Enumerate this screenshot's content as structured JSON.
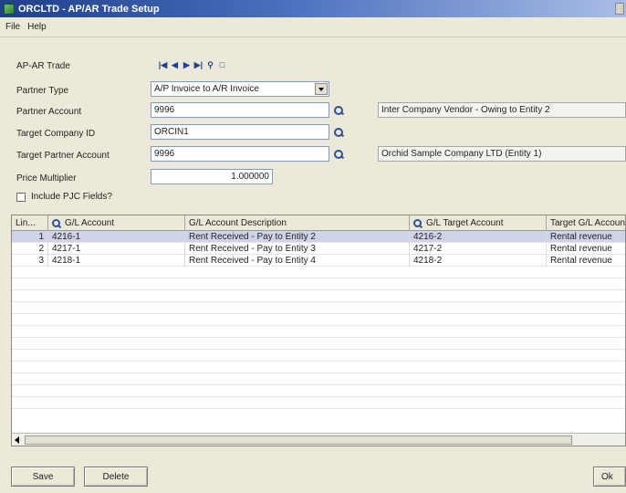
{
  "window": {
    "title": "ORCLTD - AP/AR Trade Setup"
  },
  "menu": {
    "file": "File",
    "help": "Help"
  },
  "form": {
    "trade_label": "AP-AR Trade",
    "partner_type_label": "Partner Type",
    "partner_type_value": "A/P Invoice to A/R Invoice",
    "partner_account_label": "Partner Account",
    "partner_account_value": "9996",
    "partner_account_desc": "Inter Company Vendor - Owing to Entity 2",
    "target_company_label": "Target Company ID",
    "target_company_value": "ORCIN1",
    "target_partner_label": "Target Partner Account",
    "target_partner_value": "9996",
    "target_partner_desc": "Orchid Sample Company LTD (Entity 1)",
    "price_multiplier_label": "Price Multiplier",
    "price_multiplier_value": "1.000000",
    "include_pjc_label": "Include PJC Fields?"
  },
  "grid": {
    "headers": {
      "line": "Lin...",
      "gl_account": "G/L Account",
      "gl_desc": "G/L Account Description",
      "gl_target": "G/L Target Account",
      "target_desc": "Target G/L Account"
    },
    "rows": [
      {
        "line": "1",
        "account": "4216-1",
        "description": "Rent Received - Pay to Entity 2",
        "target": "4216-2",
        "target_desc": "Rental revenue"
      },
      {
        "line": "2",
        "account": "4217-1",
        "description": "Rent Received - Pay to Entity 3",
        "target": "4217-2",
        "target_desc": "Rental revenue"
      },
      {
        "line": "3",
        "account": "4218-1",
        "description": "Rent Received - Pay to Entity 4",
        "target": "4218-2",
        "target_desc": "Rental revenue"
      }
    ]
  },
  "buttons": {
    "save": "Save",
    "delete": "Delete",
    "ok": "Ok"
  },
  "colors": {
    "accent": "#1f3f8a",
    "selected_row": "#cfd3ea"
  }
}
